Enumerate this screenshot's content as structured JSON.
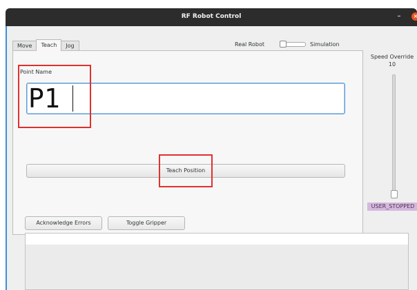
{
  "window": {
    "title": "RF Robot Control",
    "minimize_glyph": "–",
    "close_glyph": "×"
  },
  "tabs": [
    {
      "label": "Move",
      "active": false
    },
    {
      "label": "Teach",
      "active": true
    },
    {
      "label": "Jog",
      "active": false
    }
  ],
  "mode_switch": {
    "left_label": "Real Robot",
    "right_label": "Simulation"
  },
  "teach": {
    "point_name_label": "Point Name",
    "point_name_value": "P1",
    "teach_button_label": "Teach Position"
  },
  "speed": {
    "label": "Speed Override",
    "value": "10",
    "slider_fraction": 0.0
  },
  "status": {
    "text": "USER_STOPPED",
    "color": "#d6b8de"
  },
  "actions": {
    "acknowledge_label": "Acknowledge Errors",
    "toggle_gripper_label": "Toggle Gripper"
  },
  "colors": {
    "accent": "#3b8fd6",
    "highlight": "#e0302d",
    "titlebar": "#2c2c2c",
    "close": "#e95420"
  }
}
